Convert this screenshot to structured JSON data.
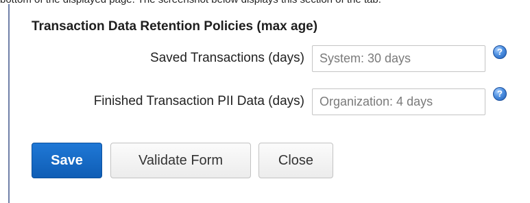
{
  "caption": "bottom of the displayed page. The screenshot below displays this section of the tab.",
  "section": {
    "title": "Transaction Data Retention Policies (max age)"
  },
  "fields": [
    {
      "label": "Saved Transactions (days)",
      "value": "",
      "placeholder": "System: 30 days",
      "help_icon": "question-circle-icon",
      "help_glyph": "?"
    },
    {
      "label": "Finished Transaction PII Data (days)",
      "value": "",
      "placeholder": "Organization: 4 days",
      "help_icon": "question-circle-icon",
      "help_glyph": "?"
    }
  ],
  "buttons": {
    "save": "Save",
    "validate": "Validate Form",
    "close": "Close"
  },
  "colors": {
    "primary_button": "#1a6fcc",
    "help_icon": "#3a7fd5",
    "left_rule": "#6f7fa8"
  }
}
